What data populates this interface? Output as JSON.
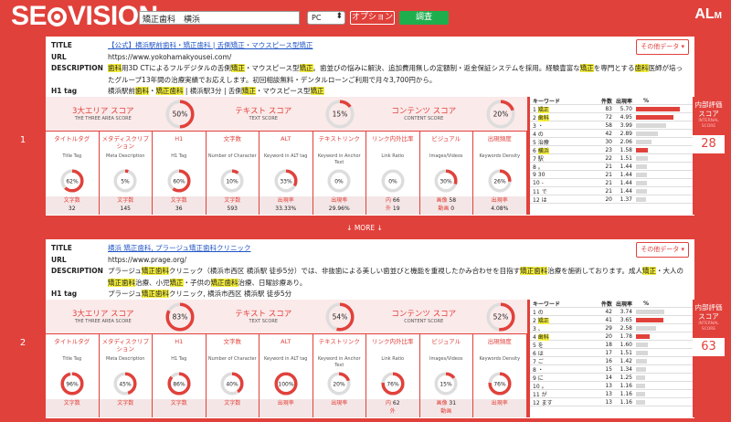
{
  "header": {
    "logo": "SEOVISION",
    "keyword": "矯正歯科　横浜",
    "device": "PC",
    "options_label": "オプション",
    "search_label": "調査",
    "brand": "ALM"
  },
  "results": [
    {
      "rank": "1",
      "title": "【公式】横浜駅前歯科・矯正歯科 | 舌側矯正・マウスピース型矯正",
      "url": "https://www.yokohamakyousei.com/",
      "description": "歯科用3D CTによるフルデジタルの舌側矯正・マウスピース型矯正。歯並びの悩みに解決、追加費用無しの定額制・返金保証システムを採用。経験豊富な矯正を専門とする歯科医師が培ったグループ13年間の治療実績でお応えします。初回相談無料・デンタルローンご利用で月々3,700円から。",
      "h1": "横浜駅前歯科・矯正歯科 | 横浜駅3分 | 舌側矯正・マウスピース型矯正",
      "other_data_label": "その他データ",
      "three_area_score": "50%",
      "text_score": "15%",
      "content_score": "20%",
      "internal_score": "28",
      "metrics": {
        "title_tag": "62%",
        "meta_desc": "5%",
        "h1": "60%",
        "characters": "10%",
        "alt": "33%",
        "anchor": "0%",
        "link_ratio": "0%",
        "visual": "30%",
        "density": "26%"
      },
      "metric_fills": {
        "title_tag": 62,
        "meta_desc": 5,
        "h1": 60,
        "characters": 10,
        "alt": 33,
        "anchor": 0,
        "link_ratio": 0,
        "visual": 30,
        "density": 26,
        "three": 50,
        "text": 15,
        "content": 20
      },
      "foot": {
        "title_tag": "32",
        "meta_desc": "145",
        "h1": "36",
        "characters": "593",
        "alt": "33.33%",
        "anchor": "29.96%",
        "link_in": "66",
        "link_out": "19",
        "images": "58",
        "videos": "0",
        "density": "4.08%"
      },
      "keywords": [
        {
          "n": "1",
          "kw": "矯正",
          "c": "83",
          "r": "5.70",
          "f": 5.7
        },
        {
          "n": "2",
          "kw": "歯科",
          "c": "72",
          "r": "4.95",
          "f": 4.95
        },
        {
          "n": "3",
          "kw": "・",
          "c": "58",
          "r": "3.99",
          "f": 3.99
        },
        {
          "n": "4",
          "kw": "の",
          "c": "42",
          "r": "2.89",
          "f": 2.89
        },
        {
          "n": "5",
          "kw": "治療",
          "c": "30",
          "r": "2.06",
          "f": 2.06
        },
        {
          "n": "6",
          "kw": "横浜",
          "c": "23",
          "r": "1.58",
          "f": 1.58
        },
        {
          "n": "7",
          "kw": "駅",
          "c": "22",
          "r": "1.51",
          "f": 1.51
        },
        {
          "n": "8",
          "kw": "。",
          "c": "21",
          "r": "1.44",
          "f": 1.44
        },
        {
          "n": "9",
          "kw": "30",
          "c": "21",
          "r": "1.44",
          "f": 1.44
        },
        {
          "n": "10",
          "kw": "-",
          "c": "21",
          "r": "1.44",
          "f": 1.44
        },
        {
          "n": "11",
          "kw": "で",
          "c": "21",
          "r": "1.44",
          "f": 1.44
        },
        {
          "n": "12",
          "kw": "は",
          "c": "20",
          "r": "1.37",
          "f": 1.37
        }
      ]
    },
    {
      "rank": "2",
      "title": "横浜 矯正歯科, プラージュ矯正歯科クリニック",
      "url": "https://www.prage.org/",
      "description": "プラージュ矯正歯科クリニック（横浜市西区 横浜駅 徒歩5分）では、非抜歯による美しい歯並びと機能を重視したかみ合わせを目指す矯正歯科治療を施術しております。成人矯正・大人の矯正歯科治療、小児矯正・子供の矯正歯科治療、日曜診療あり。",
      "h1": "プラージュ矯正歯科クリニック, 横浜市西区 横浜駅 徒歩5分",
      "other_data_label": "その他データ",
      "three_area_score": "83%",
      "text_score": "54%",
      "content_score": "52%",
      "internal_score": "63",
      "metrics": {
        "title_tag": "96%",
        "meta_desc": "45%",
        "h1": "86%",
        "characters": "40%",
        "alt": "100%",
        "anchor": "20%",
        "link_ratio": "76%",
        "visual": "15%",
        "density": "76%"
      },
      "metric_fills": {
        "title_tag": 96,
        "meta_desc": 45,
        "h1": 86,
        "characters": 40,
        "alt": 100,
        "anchor": 20,
        "link_ratio": 76,
        "visual": 15,
        "density": 76,
        "three": 83,
        "text": 54,
        "content": 52
      },
      "foot": {
        "title_tag": "",
        "meta_desc": "",
        "h1": "",
        "characters": "",
        "alt": "",
        "anchor": "",
        "link_in": "62",
        "link_out": "",
        "images": "31",
        "videos": "",
        "density": ""
      },
      "keywords": [
        {
          "n": "1",
          "kw": "の",
          "c": "42",
          "r": "3.74",
          "f": 3.74
        },
        {
          "n": "2",
          "kw": "矯正",
          "c": "41",
          "r": "3.65",
          "f": 3.65
        },
        {
          "n": "3",
          "kw": "、",
          "c": "29",
          "r": "2.58",
          "f": 2.58
        },
        {
          "n": "4",
          "kw": "歯科",
          "c": "20",
          "r": "1.78",
          "f": 1.78
        },
        {
          "n": "5",
          "kw": "を",
          "c": "18",
          "r": "1.60",
          "f": 1.6
        },
        {
          "n": "6",
          "kw": "は",
          "c": "17",
          "r": "1.51",
          "f": 1.51
        },
        {
          "n": "7",
          "kw": "ご",
          "c": "16",
          "r": "1.42",
          "f": 1.42
        },
        {
          "n": "8",
          "kw": "・",
          "c": "15",
          "r": "1.34",
          "f": 1.34
        },
        {
          "n": "9",
          "kw": "に",
          "c": "14",
          "r": "1.25",
          "f": 1.25
        },
        {
          "n": "10",
          "kw": "。",
          "c": "13",
          "r": "1.16",
          "f": 1.16
        },
        {
          "n": "11",
          "kw": "が",
          "c": "13",
          "r": "1.16",
          "f": 1.16
        },
        {
          "n": "12",
          "kw": "ます",
          "c": "13",
          "r": "1.16",
          "f": 1.16
        }
      ]
    }
  ],
  "labels": {
    "title": "TITLE",
    "url": "URL",
    "description": "DESCRIPTION",
    "h1tag": "H1 tag",
    "three_area": "3大エリア スコア",
    "three_area_en": "THE THREE AREA SCORE",
    "text_score": "テキスト スコア",
    "text_score_en": "TEXT SCORE",
    "content_score": "コンテンツ スコア",
    "content_score_en": "CONTENT SCORE",
    "title_tag": "タイトルタグ",
    "title_tag_en": "Title Tag",
    "meta": "メタディスクリプション",
    "meta_en": "Meta Description",
    "h1": "H1",
    "h1_en": "H1 Tag",
    "chars": "文字数",
    "chars_en": "Number of Character",
    "alt": "ALT",
    "alt_en": "Keyword in ALT tag",
    "anchor": "テキストリンク",
    "anchor_en": "Keyword in Anchor Text",
    "link_ratio": "リンク内外比率",
    "link_ratio_en": "Link Ratio",
    "visual": "ビジュアル",
    "visual_en": "Images/Videos",
    "density": "出現頻度",
    "density_en": "Keywords Density",
    "foot_chars": "文字数",
    "foot_freq": "出現率",
    "foot_in": "内",
    "foot_out": "外",
    "foot_img": "画像",
    "foot_vid": "動画",
    "kw_head": "キーワード",
    "count_head": "件数",
    "rate_head": "出現率",
    "pct_head": "%",
    "internal_title": "内部評価スコア",
    "internal_en": "INTERNAL SCORE",
    "more": "↓ MORE ↓"
  },
  "colors": {
    "accent": "#e1413b",
    "green": "#1fae4e",
    "highlight": "#f5ef3c",
    "link": "#1f54c4"
  }
}
